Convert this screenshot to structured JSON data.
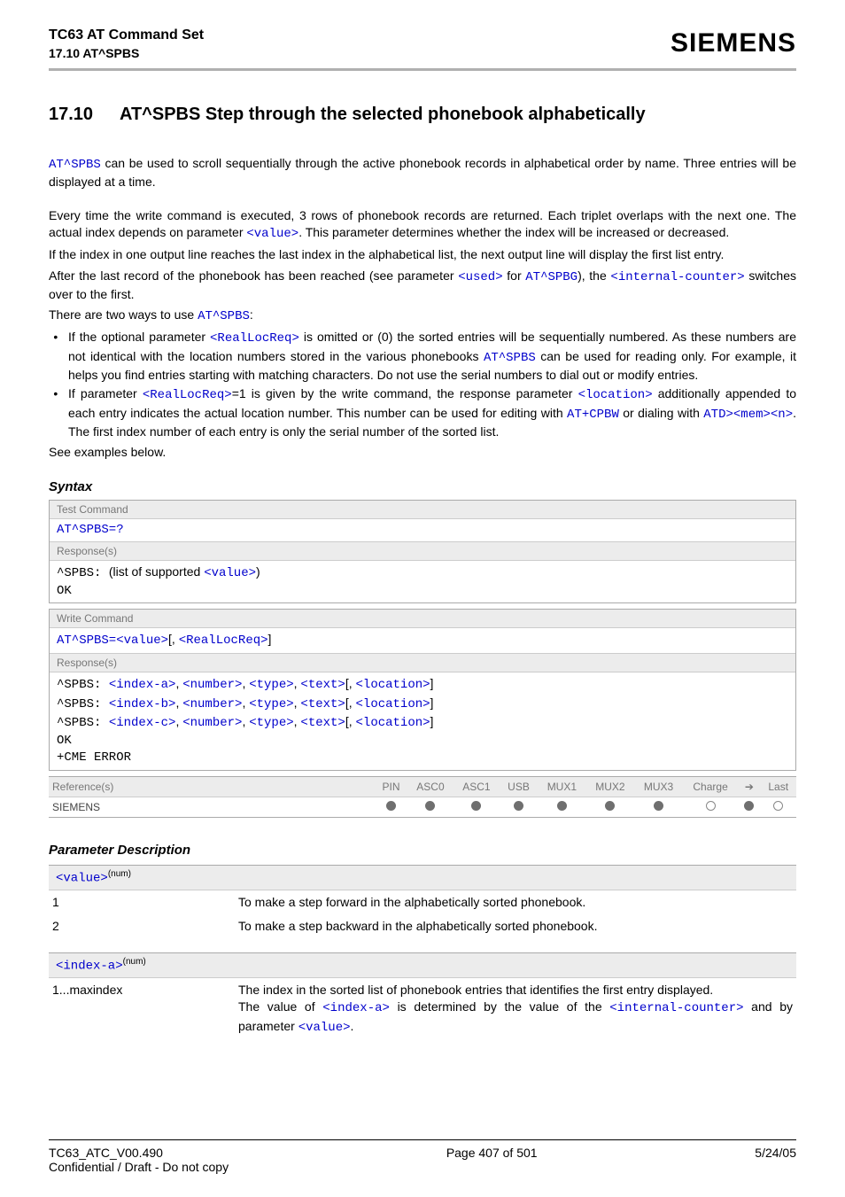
{
  "header": {
    "title": "TC63 AT Command Set",
    "sub": "17.10 AT^SPBS",
    "logo": "SIEMENS"
  },
  "section": {
    "number": "17.10",
    "title": "AT^SPBS   Step through the selected phonebook alphabetically"
  },
  "intro": {
    "p1_cmd": "AT^SPBS",
    "p1_rest": " can be used to scroll sequentially through the active phonebook records in alphabetical order by name. Three entries will be displayed at a time.",
    "p2_a": "Every time the write command is executed, 3 rows of phonebook records are returned. Each triplet overlaps with the next one. The actual index depends on parameter ",
    "p2_val": "<value>",
    "p2_b": ". This parameter determines whether the index will be increased or decreased.",
    "p3": "If the index in one output line reaches the last index in the alphabetical list, the next output line will display the first list entry.",
    "p4_a": "After the last record of the phonebook has been reached (see parameter ",
    "p4_used": "<used>",
    "p4_b": " for ",
    "p4_spbg": "AT^SPBG",
    "p4_c": "), the ",
    "p4_ic": "<internal-counter>",
    "p4_d": " switches over to the first.",
    "p5_a": "There are two ways to use ",
    "p5_cmd": "AT^SPBS",
    "p5_b": ":"
  },
  "bullets": {
    "b1_a": "If the optional parameter ",
    "b1_rlr": "<RealLocReq>",
    "b1_b": " is omitted or (0) the sorted entries will be sequentially numbered. As these numbers are not identical with the location numbers stored in the various phonebooks ",
    "b1_cmd": "AT^SPBS",
    "b1_c": " can be used for reading only. For example, it helps you find entries starting with matching characters. Do not use the serial numbers to dial out or modify entries.",
    "b2_a": "If parameter ",
    "b2_rlr": "<RealLocReq>",
    "b2_b": "=1 is given by the write command, the response parameter ",
    "b2_loc": "<location>",
    "b2_c": " additionally appended to each entry indicates the actual location number. This number can be used for editing with ",
    "b2_cpbw": "AT+CPBW",
    "b2_d": " or dialing with ",
    "b2_atd": "ATD><mem><n>",
    "b2_e": ". The first index number of each entry is only the serial number of the sorted list."
  },
  "see": "See examples below.",
  "syntax_label": "Syntax",
  "test_block": {
    "label": "Test Command",
    "cmd": "AT^SPBS=?",
    "resp_label": "Response(s)",
    "resp_prefix": "^SPBS: ",
    "resp_mid": "(list of supported ",
    "resp_val": "<value>",
    "resp_end": ")",
    "ok": "OK"
  },
  "write_block": {
    "label": "Write Command",
    "cmd_prefix": "AT^SPBS=",
    "cmd_val": "<value>",
    "cmd_sep": "[, ",
    "cmd_rlr": "<RealLocReq>",
    "cmd_close": "]",
    "resp_label": "Response(s)",
    "r1": {
      "p": "^SPBS: ",
      "a": "<index-a>",
      "n": "<number>",
      "t": "<type>",
      "x": "<text>",
      "l": "<location>"
    },
    "r2": {
      "p": "^SPBS: ",
      "a": "<index-b>",
      "n": "<number>",
      "t": "<type>",
      "x": "<text>",
      "l": "<location>"
    },
    "r3": {
      "p": "^SPBS: ",
      "a": "<index-c>",
      "n": "<number>",
      "t": "<type>",
      "x": "<text>",
      "l": "<location>"
    },
    "ok": "OK",
    "err": "+CME ERROR"
  },
  "ref": {
    "label": "Reference(s)",
    "cols": [
      "PIN",
      "ASC0",
      "ASC1",
      "USB",
      "MUX1",
      "MUX2",
      "MUX3",
      "Charge",
      "➔",
      "Last"
    ],
    "value": "SIEMENS",
    "marks": [
      "filled",
      "filled",
      "filled",
      "filled",
      "filled",
      "filled",
      "filled",
      "empty",
      "filled",
      "empty"
    ]
  },
  "param_label": "Parameter Description",
  "params": {
    "value": {
      "name": "<value>",
      "sup": "(num)",
      "rows": [
        {
          "k": "1",
          "v": "To make a step forward in the alphabetically sorted phonebook."
        },
        {
          "k": "2",
          "v": "To make a step backward in the alphabetically sorted phonebook."
        }
      ]
    },
    "indexa": {
      "name": "<index-a>",
      "sup": "(num)",
      "k": "1...maxindex",
      "v1": "The index in the sorted list of phonebook entries that identifies the first entry displayed.",
      "v2a": "The value of ",
      "v2_ia": "<index-a>",
      "v2b": " is determined by the value of the ",
      "v2_ic": "<internal-counter>",
      "v2c": " and by parameter ",
      "v2_val": "<value>",
      "v2d": "."
    }
  },
  "footer": {
    "left1": "TC63_ATC_V00.490",
    "left2": "Confidential / Draft - Do not copy",
    "center": "Page 407 of 501",
    "right": "5/24/05"
  }
}
